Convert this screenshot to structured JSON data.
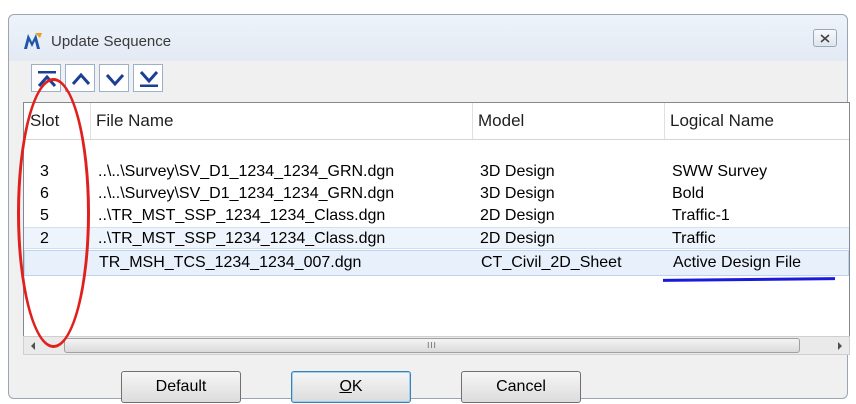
{
  "window": {
    "title": "Update Sequence",
    "icon": "bentley-m-icon",
    "close_icon": "close-icon"
  },
  "toolbar": {
    "buttons": [
      {
        "name": "move-to-top-button",
        "icon": "arrow-top-icon"
      },
      {
        "name": "move-up-button",
        "icon": "chevron-up-icon"
      },
      {
        "name": "move-down-button",
        "icon": "chevron-down-icon"
      },
      {
        "name": "move-to-bottom-button",
        "icon": "arrow-bottom-icon"
      }
    ]
  },
  "table": {
    "columns": [
      "Slot",
      "File Name",
      "Model",
      "Logical Name"
    ],
    "rows": [
      {
        "slot": "3",
        "file": "..\\..\\Survey\\SV_D1_1234_1234_GRN.dgn",
        "model": "3D Design",
        "logical": "SWW Survey"
      },
      {
        "slot": "6",
        "file": "..\\..\\Survey\\SV_D1_1234_1234_GRN.dgn",
        "model": "3D Design",
        "logical": "Bold"
      },
      {
        "slot": "5",
        "file": "..\\TR_MST_SSP_1234_1234_Class.dgn",
        "model": "2D Design",
        "logical": "Traffic-1"
      },
      {
        "slot": "2",
        "file": "..\\TR_MST_SSP_1234_1234_Class.dgn",
        "model": "2D Design",
        "logical": "Traffic"
      },
      {
        "slot": "",
        "file": "TR_MSH_TCS_1234_1234_007.dgn",
        "model": "CT_Civil_2D_Sheet",
        "logical": "Active Design File"
      }
    ]
  },
  "scrollbar": {
    "grip": "III"
  },
  "buttons": {
    "default_label": "Default",
    "ok_label_mnemonic": "O",
    "ok_label_rest": "K",
    "cancel_label": "Cancel"
  },
  "colors": {
    "annotation_circle": "#e0201c",
    "annotation_underline": "#1a1adb",
    "selected_row": "#e8f1fb"
  }
}
